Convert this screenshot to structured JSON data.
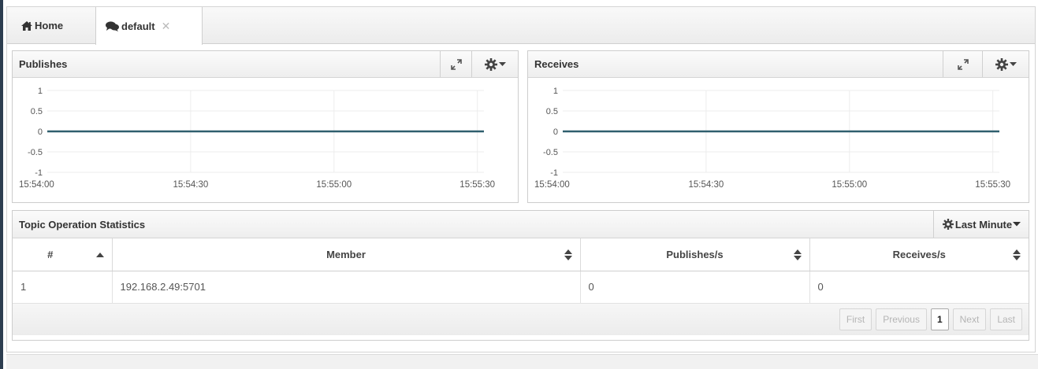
{
  "tabs": [
    {
      "label": "Home",
      "icon": "home-icon"
    },
    {
      "label": "default",
      "icon": "comments-icon",
      "close": "✕"
    }
  ],
  "publishes_panel": {
    "title": "Publishes",
    "chart_data": {
      "type": "line",
      "title": "Publishes",
      "x": [
        "15:54:00",
        "15:54:30",
        "15:55:00",
        "15:55:30"
      ],
      "xticks": [
        "15:54:00",
        "15:54:30",
        "15:55:00",
        "15:55:30"
      ],
      "yticks": [
        "1",
        "0.5",
        "0",
        "-0.5",
        "-1"
      ],
      "ylim": [
        -1,
        1
      ],
      "series": [
        {
          "values": [
            0,
            0,
            0,
            0
          ],
          "color": "#2f5f6e"
        }
      ],
      "grid": true
    }
  },
  "receives_panel": {
    "title": "Receives",
    "chart_data": {
      "type": "line",
      "title": "Receives",
      "x": [
        "15:54:00",
        "15:54:30",
        "15:55:00",
        "15:55:30"
      ],
      "xticks": [
        "15:54:00",
        "15:54:30",
        "15:55:00",
        "15:55:30"
      ],
      "yticks": [
        "1",
        "0.5",
        "0",
        "-0.5",
        "-1"
      ],
      "ylim": [
        -1,
        1
      ],
      "series": [
        {
          "values": [
            0,
            0,
            0,
            0
          ],
          "color": "#2f5f6e"
        }
      ],
      "grid": true
    }
  },
  "stats": {
    "title": "Topic Operation Statistics",
    "range_label": "Last Minute",
    "columns": [
      "#",
      "Member",
      "Publishes/s",
      "Receives/s"
    ],
    "rows": [
      [
        "1",
        "192.168.2.49:5701",
        "0",
        "0"
      ]
    ],
    "pager": {
      "first": "First",
      "previous": "Previous",
      "page": "1",
      "next": "Next",
      "last": "Last"
    }
  },
  "colors": {
    "accent": "#2f5f6e",
    "sidebar": "#2d3e50"
  }
}
